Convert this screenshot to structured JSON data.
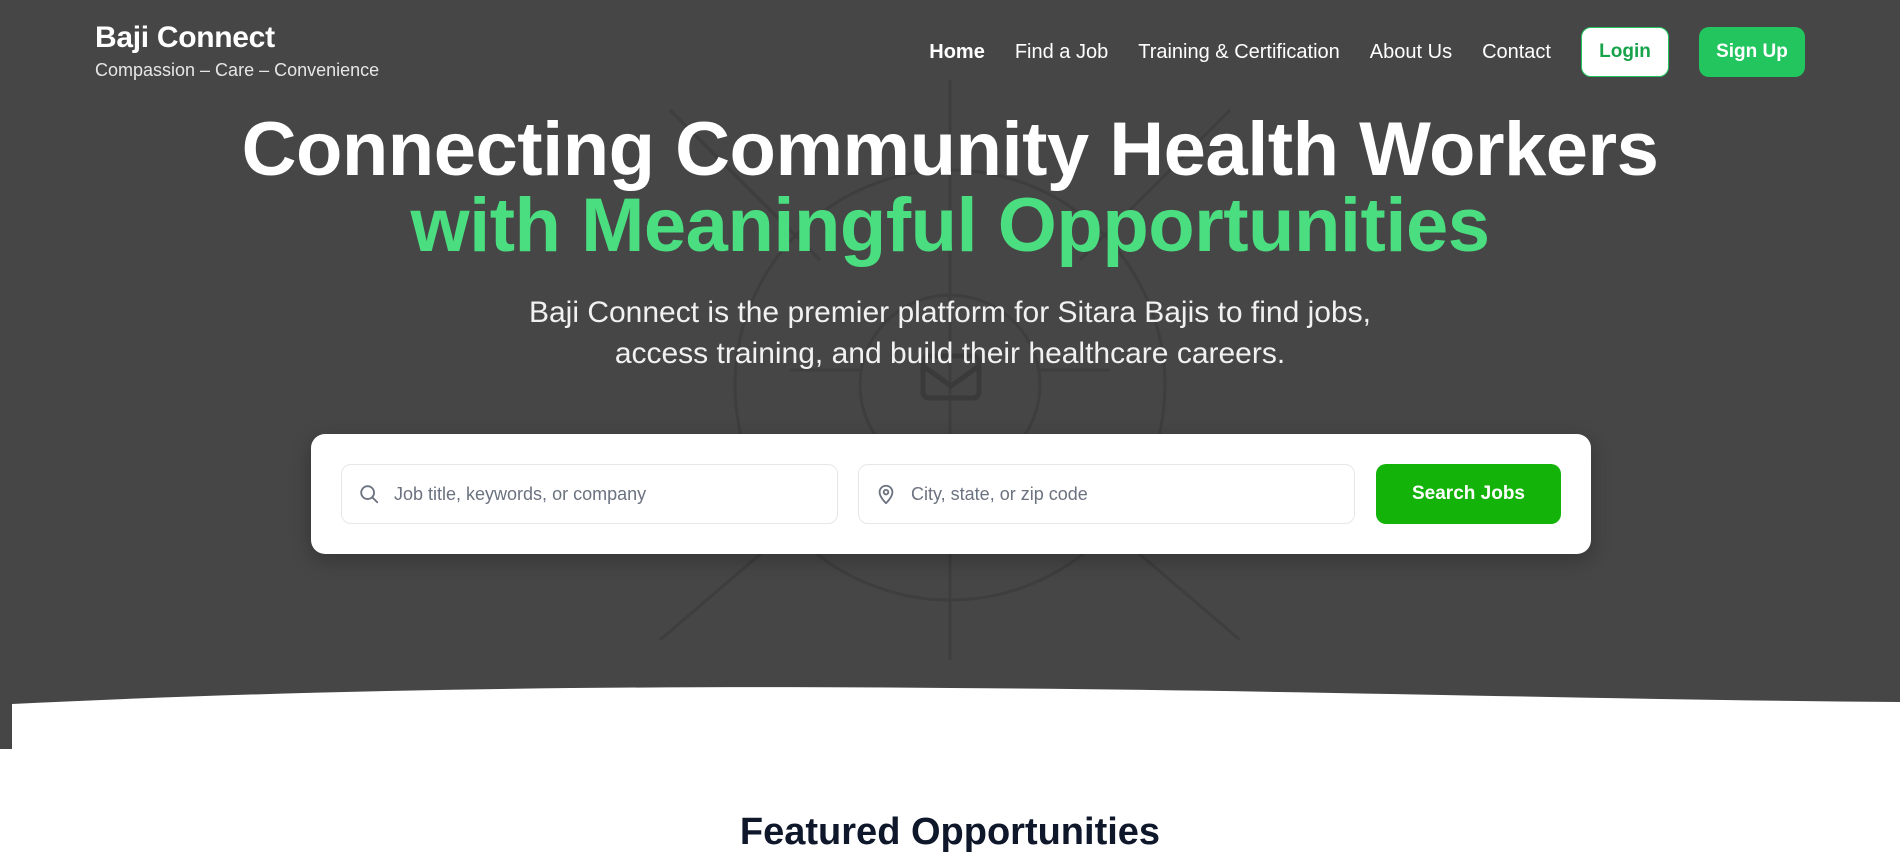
{
  "header": {
    "brand_name": "Baji Connect",
    "tagline": "Compassion – Care – Convenience",
    "nav": [
      {
        "label": "Home",
        "active": true
      },
      {
        "label": "Find a Job"
      },
      {
        "label": "Training & Certification"
      },
      {
        "label": "About Us"
      },
      {
        "label": "Contact"
      }
    ],
    "login_label": "Login",
    "signup_label": "Sign Up"
  },
  "hero": {
    "headline_line1": "Connecting Community Health Workers",
    "headline_line2": "with Meaningful Opportunities",
    "subtitle_line1": "Baji Connect is the premier platform for Sitara Bajis to find jobs,",
    "subtitle_line2": "access training, and build their healthcare careers."
  },
  "search": {
    "job_placeholder": "Job title, keywords, or company",
    "job_value": "",
    "location_placeholder": "City, state, or zip code",
    "location_value": "",
    "button_label": "Search Jobs",
    "job_icon": "search-icon",
    "location_icon": "map-pin-icon"
  },
  "featured": {
    "title": "Featured Opportunities"
  },
  "colors": {
    "hero_bg": "#464646",
    "accent_green": "#4ade80",
    "button_green": "#22c55e",
    "search_button": "#14b30a"
  }
}
